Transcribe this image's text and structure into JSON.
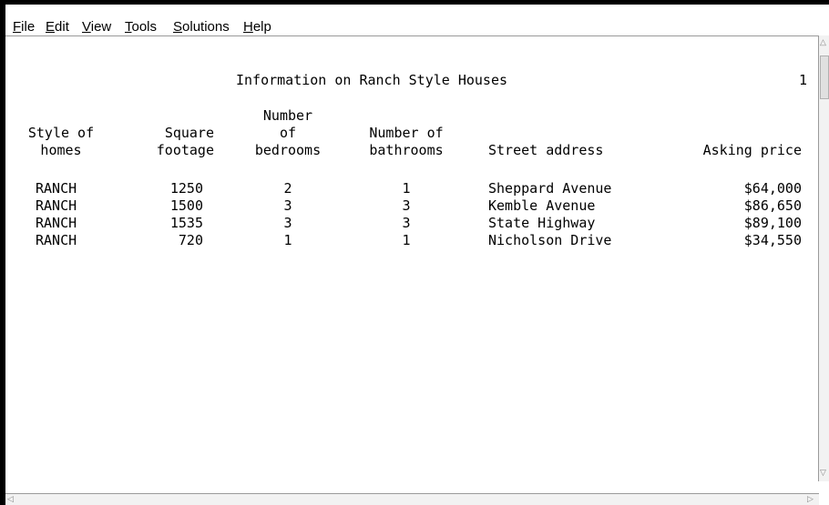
{
  "menu": {
    "items": [
      {
        "mnemonic": "F",
        "rest": "ile"
      },
      {
        "mnemonic": "E",
        "rest": "dit"
      },
      {
        "mnemonic": "V",
        "rest": "iew"
      },
      {
        "mnemonic": "T",
        "rest": "ools"
      },
      {
        "mnemonic": "S",
        "rest": "olutions"
      },
      {
        "mnemonic": "H",
        "rest": "elp"
      }
    ]
  },
  "report": {
    "title": "Information on Ranch Style Houses",
    "page_number": "1",
    "headers": {
      "style_line1": "Style of",
      "style_line2": "homes",
      "sqft_line1": "Square",
      "sqft_line2": "footage",
      "bed_line1": "Number",
      "bed_line2": "of",
      "bed_line3": "bedrooms",
      "bath_line1": "Number of",
      "bath_line2": "bathrooms",
      "street": "Street address",
      "price": "Asking price"
    },
    "rows": [
      {
        "style": "RANCH",
        "sqft": "1250",
        "bedrooms": "2",
        "bathrooms": "1",
        "street": "Sheppard Avenue",
        "price": "$64,000"
      },
      {
        "style": "RANCH",
        "sqft": "1500",
        "bedrooms": "3",
        "bathrooms": "3",
        "street": "Kemble Avenue",
        "price": "$86,650"
      },
      {
        "style": "RANCH",
        "sqft": "1535",
        "bedrooms": "3",
        "bathrooms": "3",
        "street": "State Highway",
        "price": "$89,100"
      },
      {
        "style": "RANCH",
        "sqft": "720",
        "bedrooms": "1",
        "bathrooms": "1",
        "street": "Nicholson Drive",
        "price": "$34,550"
      }
    ]
  }
}
